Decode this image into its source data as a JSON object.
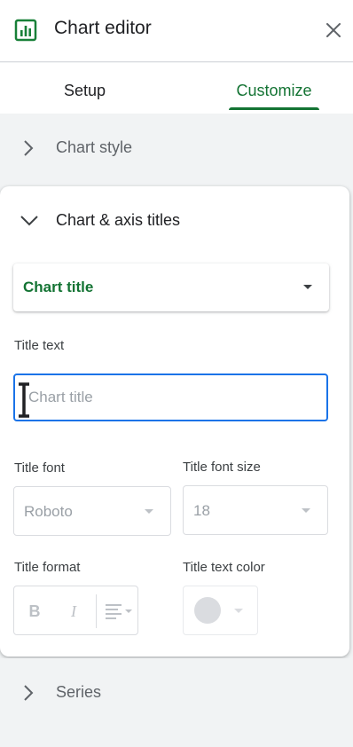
{
  "header": {
    "title": "Chart editor",
    "logo_icon": "chart-icon",
    "close_icon": "close-icon"
  },
  "tabs": [
    {
      "label": "Setup",
      "active": false
    },
    {
      "label": "Customize",
      "active": true
    }
  ],
  "sections": {
    "chart_style": {
      "label": "Chart style",
      "expanded": false
    },
    "chart_axis_titles": {
      "label": "Chart & axis titles",
      "expanded": true
    },
    "series": {
      "label": "Series",
      "expanded": false
    }
  },
  "titles_panel": {
    "target_dropdown": "Chart title",
    "title_text_label": "Title text",
    "title_text_value": "",
    "title_text_placeholder": "Chart title",
    "title_font_label": "Title font",
    "title_font_value": "Roboto",
    "title_font_size_label": "Title font size",
    "title_font_size_value": "18",
    "title_format_label": "Title format",
    "title_format_bold": "B",
    "title_format_italic": "I",
    "title_text_color_label": "Title text color"
  },
  "colors": {
    "accent_green": "#137333",
    "focus_blue": "#1a73e8",
    "disabled": "#9aa0a6",
    "swatch": "#dadce0"
  }
}
